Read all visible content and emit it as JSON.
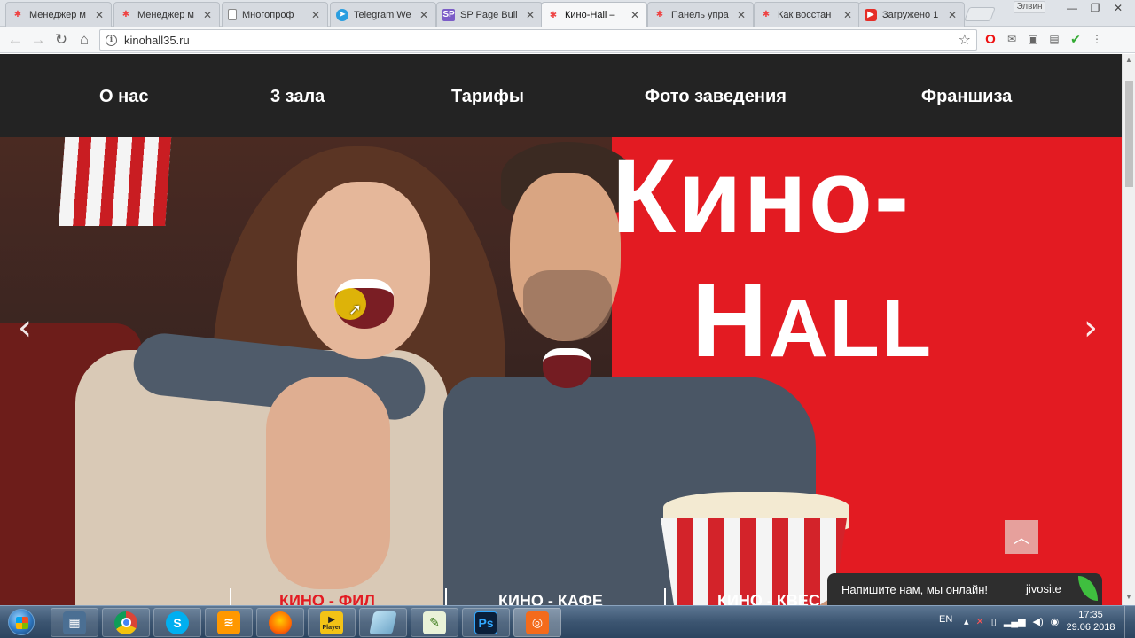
{
  "browser": {
    "tabs": [
      {
        "title": "Менеджер м",
        "icon": "joomla-icon"
      },
      {
        "title": "Менеджер м",
        "icon": "joomla-icon"
      },
      {
        "title": "Многопроф",
        "icon": "page-icon"
      },
      {
        "title": "Telegram We",
        "icon": "telegram-icon"
      },
      {
        "title": "SP Page Buil",
        "icon": "sp-icon"
      },
      {
        "title": "Кино-Hall –",
        "icon": "joomla-icon",
        "active": true
      },
      {
        "title": "Панель упра",
        "icon": "joomla-icon"
      },
      {
        "title": "Как восстан",
        "icon": "joomla-icon"
      },
      {
        "title": "Загружено 1",
        "icon": "youtube-icon"
      }
    ],
    "profile_name": "Элвин",
    "url": "kinohall35.ru"
  },
  "site": {
    "nav": [
      "О нас",
      "3 зала",
      "Тарифы",
      "Фото заведения",
      "Франшиза"
    ],
    "hero": {
      "title_line1": "Кино-",
      "title_line2_cap": "H",
      "title_line2_rest": "ALL"
    },
    "bottom_tabs": [
      "КИНО - ФИЛ",
      "КИНО - КАФЕ",
      "КИНО - КВЕС"
    ],
    "chat": {
      "text": "Напишите нам, мы онлайн!",
      "brand": "jivosite"
    },
    "accent_color": "#e31b22",
    "nav_bg_color": "#232323"
  },
  "taskbar": {
    "apps": [
      "explorer",
      "chrome",
      "skype",
      "sublime",
      "firefox",
      "player",
      "notes",
      "notepad",
      "photoshop",
      "recorder"
    ],
    "player_label": "Player",
    "photoshop_label": "Ps",
    "skype_label": "S",
    "language": "EN",
    "time": "17:35",
    "date": "29.06.2018"
  }
}
